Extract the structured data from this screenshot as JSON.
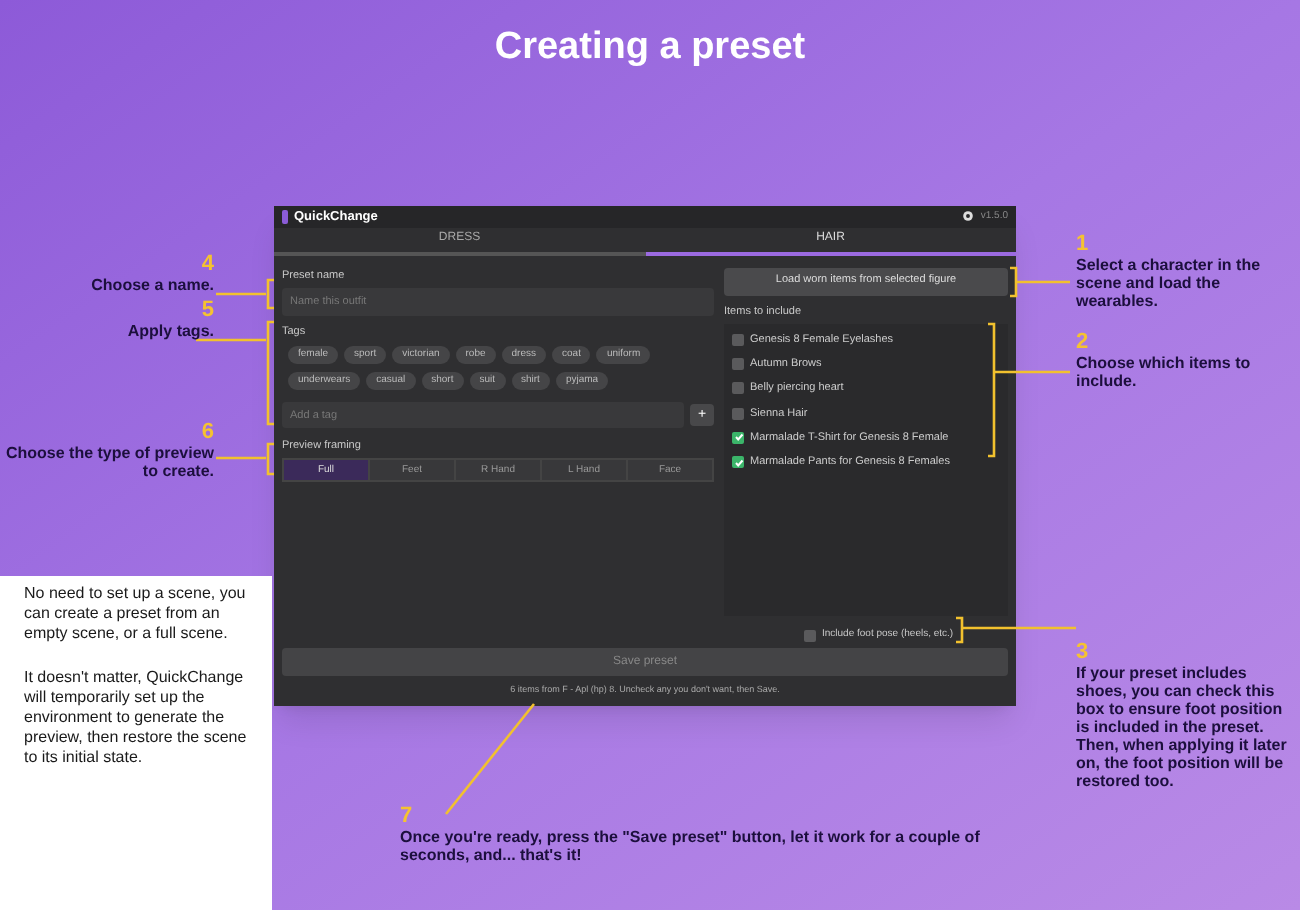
{
  "heading": "Creating a preset",
  "window": {
    "title": "QuickChange",
    "version": "v1.5.0"
  },
  "tabs": [
    {
      "label": "DRESS",
      "selected": false
    },
    {
      "label": "HAIR",
      "selected": true
    }
  ],
  "preset_name": {
    "label": "Preset name",
    "placeholder": "Name this outfit"
  },
  "tags": {
    "label": "Tags",
    "items": [
      "female",
      "sport",
      "victorian",
      "robe",
      "dress",
      "coat",
      "uniform",
      "underwears",
      "casual",
      "short",
      "suit",
      "shirt",
      "pyjama"
    ],
    "add_placeholder": "Add a tag",
    "add_button": "+"
  },
  "preview_framing": {
    "label": "Preview framing",
    "options": [
      {
        "label": "Full",
        "selected": true
      },
      {
        "label": "Feet",
        "selected": false
      },
      {
        "label": "R Hand",
        "selected": false
      },
      {
        "label": "L Hand",
        "selected": false
      },
      {
        "label": "Face",
        "selected": false
      }
    ]
  },
  "load_button": "Load worn items from selected figure",
  "items_label": "Items to include",
  "items": [
    {
      "label": "Genesis 8 Female Eyelashes",
      "checked": false
    },
    {
      "label": "Autumn Brows",
      "checked": false
    },
    {
      "label": "Belly piercing heart",
      "checked": false
    },
    {
      "label": "Sienna Hair",
      "checked": false
    },
    {
      "label": "Marmalade T-Shirt for Genesis 8 Female",
      "checked": true
    },
    {
      "label": "Marmalade Pants for Genesis 8 Females",
      "checked": true
    }
  ],
  "foot_pose": {
    "label": "Include foot pose (heels, etc.)",
    "checked": false
  },
  "save_button": "Save preset",
  "footer": "6 items from F - Apl (hp) 8. Uncheck any you don't want, then Save.",
  "callouts": [
    {
      "number": "4",
      "text": "Choose a name."
    },
    {
      "number": "5",
      "text": "Apply tags."
    },
    {
      "number": "6",
      "text": "Choose the type of preview to create."
    },
    {
      "number": "1",
      "text": "Select a character in the scene and load the wearables."
    },
    {
      "number": "2",
      "text": "Choose which items to include."
    },
    {
      "number": "3",
      "text": "If your preset includes shoes, you can check this box to ensure foot position is included in the preset.\nThen, when applying it later on, the foot position will be restored too."
    },
    {
      "number": "7",
      "text": "Once you're ready, press the \"Save preset\" button, let it work for a couple of seconds, and... that's it!"
    }
  ],
  "notes": [
    "No need to set up a scene, you can create a preset from an empty scene, or a full scene.",
    "It doesn't matter, QuickChange will temporarily set up the environment to generate the preview, then restore the scene to its initial state."
  ]
}
